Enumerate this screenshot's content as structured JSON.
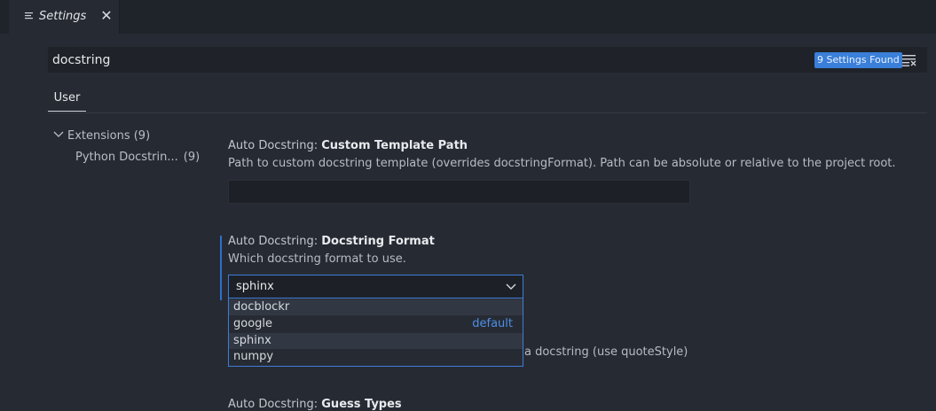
{
  "editor": {
    "tab_title": "Settings",
    "close_glyph": "✕"
  },
  "search": {
    "value": "docstring",
    "results_badge": "9 Settings Found"
  },
  "scope_tabs": {
    "user": "User"
  },
  "toc": {
    "extensions_label": "Extensions (9)",
    "python_docstring_label": "Python Docstrin...",
    "python_docstring_count": "(9)"
  },
  "settings": {
    "custom_template": {
      "category": "Auto Docstring: ",
      "name": "Custom Template Path",
      "description": "Path to custom docstring template (overrides docstringFormat). Path can be absolute or relative to the project root.",
      "value": ""
    },
    "docstring_format": {
      "category": "Auto Docstring: ",
      "name": "Docstring Format",
      "description": "Which docstring format to use.",
      "selected": "sphinx",
      "options": [
        {
          "label": "docblockr",
          "tag": ""
        },
        {
          "label": "google",
          "tag": "default"
        },
        {
          "label": "sphinx",
          "tag": ""
        },
        {
          "label": "numpy",
          "tag": ""
        }
      ]
    },
    "partial_hidden_desc": "a docstring (use quoteStyle)",
    "guess_types": {
      "category": "Auto Docstring: ",
      "name": "Guess Types"
    }
  },
  "colors": {
    "accent": "#3a7fd9",
    "background": "#262b33"
  },
  "icons": {
    "tab": "settings-lines-icon",
    "clear": "clear-filter-icon",
    "chevron": "chevron-down-icon"
  }
}
